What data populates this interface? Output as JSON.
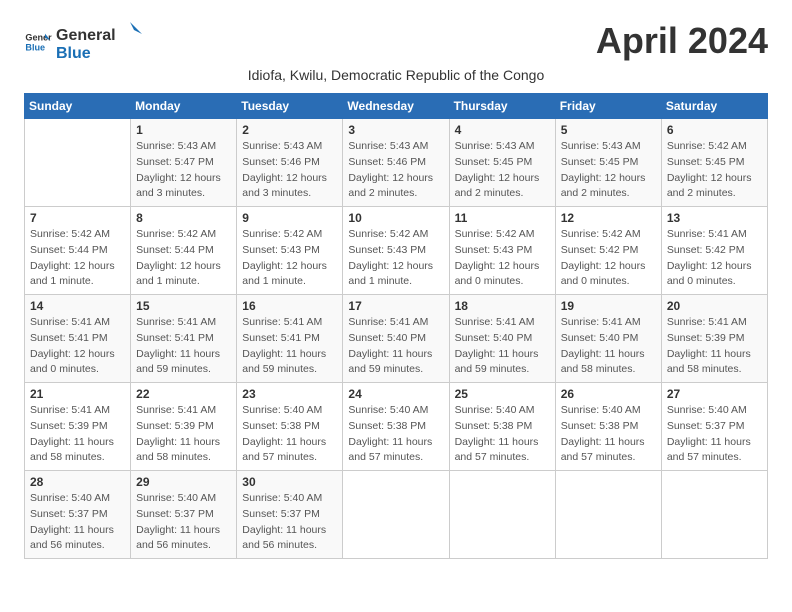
{
  "header": {
    "logo_general": "General",
    "logo_blue": "Blue",
    "month_title": "April 2024",
    "subtitle": "Idiofa, Kwilu, Democratic Republic of the Congo"
  },
  "weekdays": [
    "Sunday",
    "Monday",
    "Tuesday",
    "Wednesday",
    "Thursday",
    "Friday",
    "Saturday"
  ],
  "weeks": [
    [
      {
        "day": "",
        "info": ""
      },
      {
        "day": "1",
        "info": "Sunrise: 5:43 AM\nSunset: 5:47 PM\nDaylight: 12 hours\nand 3 minutes."
      },
      {
        "day": "2",
        "info": "Sunrise: 5:43 AM\nSunset: 5:46 PM\nDaylight: 12 hours\nand 3 minutes."
      },
      {
        "day": "3",
        "info": "Sunrise: 5:43 AM\nSunset: 5:46 PM\nDaylight: 12 hours\nand 2 minutes."
      },
      {
        "day": "4",
        "info": "Sunrise: 5:43 AM\nSunset: 5:45 PM\nDaylight: 12 hours\nand 2 minutes."
      },
      {
        "day": "5",
        "info": "Sunrise: 5:43 AM\nSunset: 5:45 PM\nDaylight: 12 hours\nand 2 minutes."
      },
      {
        "day": "6",
        "info": "Sunrise: 5:42 AM\nSunset: 5:45 PM\nDaylight: 12 hours\nand 2 minutes."
      }
    ],
    [
      {
        "day": "7",
        "info": "Sunrise: 5:42 AM\nSunset: 5:44 PM\nDaylight: 12 hours\nand 1 minute."
      },
      {
        "day": "8",
        "info": "Sunrise: 5:42 AM\nSunset: 5:44 PM\nDaylight: 12 hours\nand 1 minute."
      },
      {
        "day": "9",
        "info": "Sunrise: 5:42 AM\nSunset: 5:43 PM\nDaylight: 12 hours\nand 1 minute."
      },
      {
        "day": "10",
        "info": "Sunrise: 5:42 AM\nSunset: 5:43 PM\nDaylight: 12 hours\nand 1 minute."
      },
      {
        "day": "11",
        "info": "Sunrise: 5:42 AM\nSunset: 5:43 PM\nDaylight: 12 hours\nand 0 minutes."
      },
      {
        "day": "12",
        "info": "Sunrise: 5:42 AM\nSunset: 5:42 PM\nDaylight: 12 hours\nand 0 minutes."
      },
      {
        "day": "13",
        "info": "Sunrise: 5:41 AM\nSunset: 5:42 PM\nDaylight: 12 hours\nand 0 minutes."
      }
    ],
    [
      {
        "day": "14",
        "info": "Sunrise: 5:41 AM\nSunset: 5:41 PM\nDaylight: 12 hours\nand 0 minutes."
      },
      {
        "day": "15",
        "info": "Sunrise: 5:41 AM\nSunset: 5:41 PM\nDaylight: 11 hours\nand 59 minutes."
      },
      {
        "day": "16",
        "info": "Sunrise: 5:41 AM\nSunset: 5:41 PM\nDaylight: 11 hours\nand 59 minutes."
      },
      {
        "day": "17",
        "info": "Sunrise: 5:41 AM\nSunset: 5:40 PM\nDaylight: 11 hours\nand 59 minutes."
      },
      {
        "day": "18",
        "info": "Sunrise: 5:41 AM\nSunset: 5:40 PM\nDaylight: 11 hours\nand 59 minutes."
      },
      {
        "day": "19",
        "info": "Sunrise: 5:41 AM\nSunset: 5:40 PM\nDaylight: 11 hours\nand 58 minutes."
      },
      {
        "day": "20",
        "info": "Sunrise: 5:41 AM\nSunset: 5:39 PM\nDaylight: 11 hours\nand 58 minutes."
      }
    ],
    [
      {
        "day": "21",
        "info": "Sunrise: 5:41 AM\nSunset: 5:39 PM\nDaylight: 11 hours\nand 58 minutes."
      },
      {
        "day": "22",
        "info": "Sunrise: 5:41 AM\nSunset: 5:39 PM\nDaylight: 11 hours\nand 58 minutes."
      },
      {
        "day": "23",
        "info": "Sunrise: 5:40 AM\nSunset: 5:38 PM\nDaylight: 11 hours\nand 57 minutes."
      },
      {
        "day": "24",
        "info": "Sunrise: 5:40 AM\nSunset: 5:38 PM\nDaylight: 11 hours\nand 57 minutes."
      },
      {
        "day": "25",
        "info": "Sunrise: 5:40 AM\nSunset: 5:38 PM\nDaylight: 11 hours\nand 57 minutes."
      },
      {
        "day": "26",
        "info": "Sunrise: 5:40 AM\nSunset: 5:38 PM\nDaylight: 11 hours\nand 57 minutes."
      },
      {
        "day": "27",
        "info": "Sunrise: 5:40 AM\nSunset: 5:37 PM\nDaylight: 11 hours\nand 57 minutes."
      }
    ],
    [
      {
        "day": "28",
        "info": "Sunrise: 5:40 AM\nSunset: 5:37 PM\nDaylight: 11 hours\nand 56 minutes."
      },
      {
        "day": "29",
        "info": "Sunrise: 5:40 AM\nSunset: 5:37 PM\nDaylight: 11 hours\nand 56 minutes."
      },
      {
        "day": "30",
        "info": "Sunrise: 5:40 AM\nSunset: 5:37 PM\nDaylight: 11 hours\nand 56 minutes."
      },
      {
        "day": "",
        "info": ""
      },
      {
        "day": "",
        "info": ""
      },
      {
        "day": "",
        "info": ""
      },
      {
        "day": "",
        "info": ""
      }
    ]
  ]
}
